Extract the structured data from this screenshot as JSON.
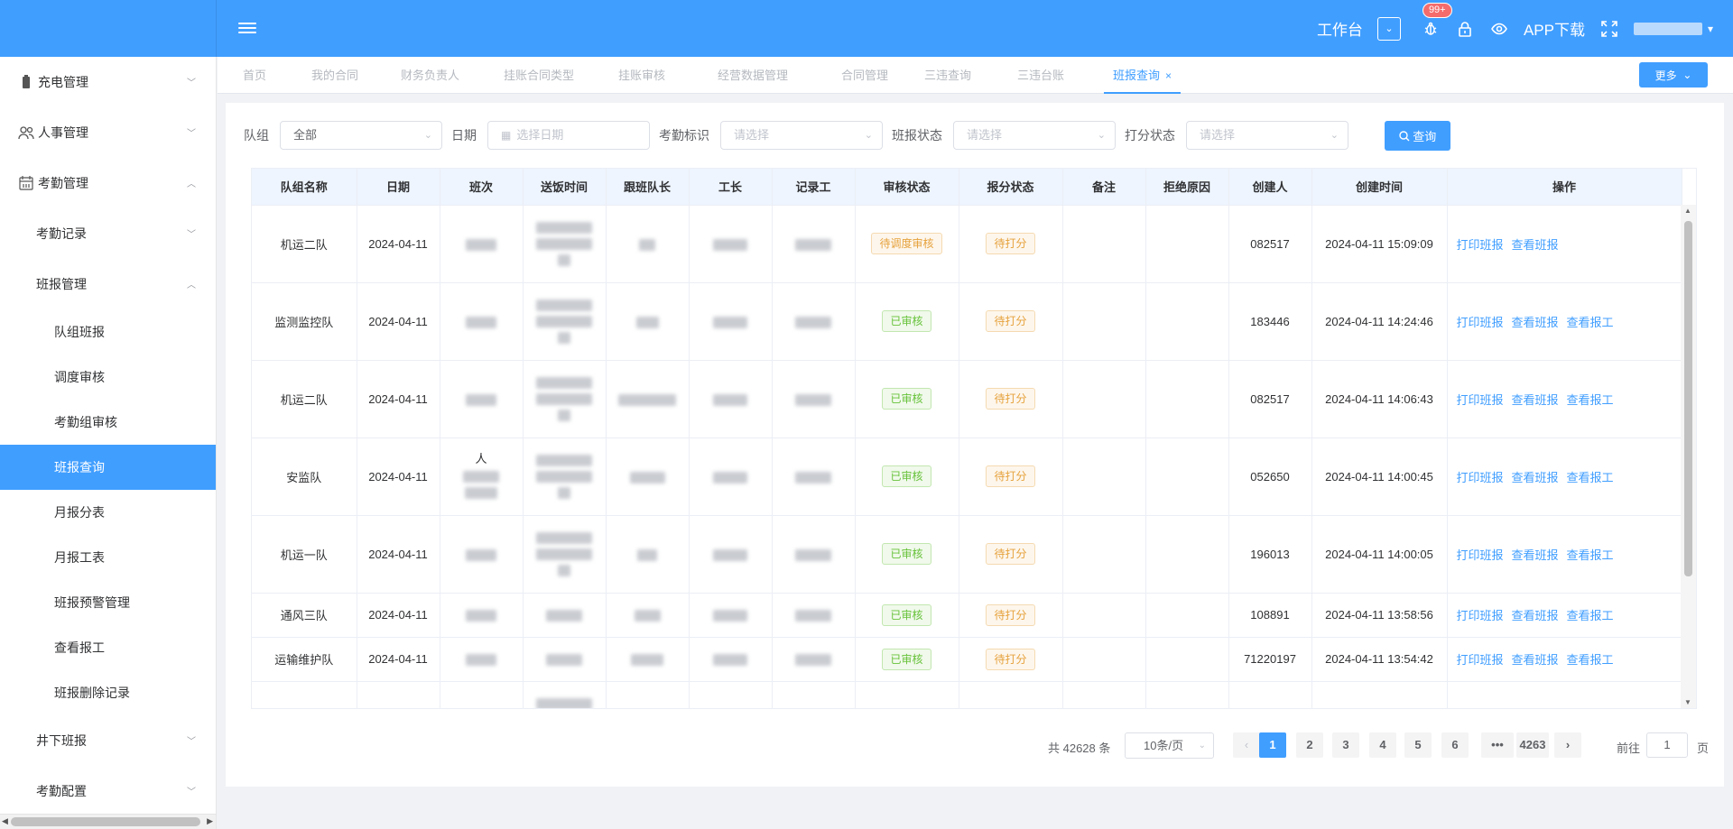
{
  "header": {
    "workbench": "工作台",
    "badge": "99+",
    "app_download": "APP下载"
  },
  "sidebar": {
    "items": [
      {
        "label": "充电管理",
        "level": 1,
        "arrow": "down"
      },
      {
        "label": "人事管理",
        "level": 1,
        "arrow": "down"
      },
      {
        "label": "考勤管理",
        "level": 1,
        "arrow": "up"
      },
      {
        "label": "考勤记录",
        "level": 2,
        "arrow": "down"
      },
      {
        "label": "班报管理",
        "level": 2,
        "arrow": "up"
      },
      {
        "label": "队组班报",
        "level": 3
      },
      {
        "label": "调度审核",
        "level": 3
      },
      {
        "label": "考勤组审核",
        "level": 3
      },
      {
        "label": "班报查询",
        "level": 3,
        "active": true
      },
      {
        "label": "月报分表",
        "level": 3
      },
      {
        "label": "月报工表",
        "level": 3
      },
      {
        "label": "班报预警管理",
        "level": 3
      },
      {
        "label": "查看报工",
        "level": 3
      },
      {
        "label": "班报删除记录",
        "level": 3
      },
      {
        "label": "井下班报",
        "level": 2,
        "arrow": "down"
      },
      {
        "label": "考勤配置",
        "level": 2,
        "arrow": "down"
      }
    ]
  },
  "tabs": {
    "items": [
      "首页",
      "我的合同",
      "财务负责人",
      "挂账合同类型",
      "挂账审核",
      "经营数据管理",
      "合同管理",
      "三违查询",
      "三违台账",
      "班报查询"
    ],
    "active": "班报查询",
    "more": "更多"
  },
  "filters": {
    "team_label": "队组",
    "team_value": "全部",
    "date_label": "日期",
    "date_placeholder": "选择日期",
    "mark_label": "考勤标识",
    "mark_placeholder": "请选择",
    "report_status_label": "班报状态",
    "report_status_placeholder": "请选择",
    "score_status_label": "打分状态",
    "score_status_placeholder": "请选择",
    "query": "查询"
  },
  "table": {
    "columns": [
      "队组名称",
      "日期",
      "班次",
      "送饭时间",
      "跟班队长",
      "工长",
      "记录工",
      "审核状态",
      "报分状态",
      "备注",
      "拒绝原因",
      "创建人",
      "创建时间",
      "操作"
    ],
    "rows": [
      {
        "team": "机运二队",
        "date": "2024-04-11",
        "audit": "待调度审核",
        "audit_type": "warn",
        "score": "待打分",
        "creator": "082517",
        "created": "2024-04-11 15:09:09",
        "ops": [
          "打印班报",
          "查看班报"
        ]
      },
      {
        "team": "监测监控队",
        "date": "2024-04-11",
        "audit": "已审核",
        "audit_type": "ok",
        "score": "待打分",
        "creator": "183446",
        "created": "2024-04-11 14:24:46",
        "ops": [
          "打印班报",
          "查看班报",
          "查看报工"
        ]
      },
      {
        "team": "机运二队",
        "date": "2024-04-11",
        "audit": "已审核",
        "audit_type": "ok",
        "score": "待打分",
        "creator": "082517",
        "created": "2024-04-11 14:06:43",
        "ops": [
          "打印班报",
          "查看班报",
          "查看报工"
        ]
      },
      {
        "team": "安监队",
        "date": "2024-04-11",
        "audit": "已审核",
        "audit_type": "ok",
        "score": "待打分",
        "creator": "052650",
        "created": "2024-04-11 14:00:45",
        "ops": [
          "打印班报",
          "查看班报",
          "查看报工"
        ],
        "shift_prefix": "人"
      },
      {
        "team": "机运一队",
        "date": "2024-04-11",
        "audit": "已审核",
        "audit_type": "ok",
        "score": "待打分",
        "creator": "196013",
        "created": "2024-04-11 14:00:05",
        "ops": [
          "打印班报",
          "查看班报",
          "查看报工"
        ]
      },
      {
        "team": "通风三队",
        "date": "2024-04-11",
        "audit": "已审核",
        "audit_type": "ok",
        "score": "待打分",
        "creator": "108891",
        "created": "2024-04-11 13:58:56",
        "ops": [
          "打印班报",
          "查看班报",
          "查看报工"
        ]
      },
      {
        "team": "运输维护队",
        "date": "2024-04-11",
        "audit": "已审核",
        "audit_type": "ok",
        "score": "待打分",
        "creator": "71220197",
        "created": "2024-04-11 13:54:42",
        "ops": [
          "打印班报",
          "查看班报",
          "查看报工"
        ]
      }
    ]
  },
  "pagination": {
    "total": "共 42628 条",
    "page_size": "10条/页",
    "pages": [
      "1",
      "2",
      "3",
      "4",
      "5",
      "6",
      "•••",
      "4263"
    ],
    "current": "1",
    "goto_label": "前往",
    "goto_value": "1",
    "page_suffix": "页"
  },
  "colors": {
    "primary": "#409eff",
    "warning": "#e6a23c",
    "success": "#67c23a",
    "badge": "#f56c6c"
  }
}
